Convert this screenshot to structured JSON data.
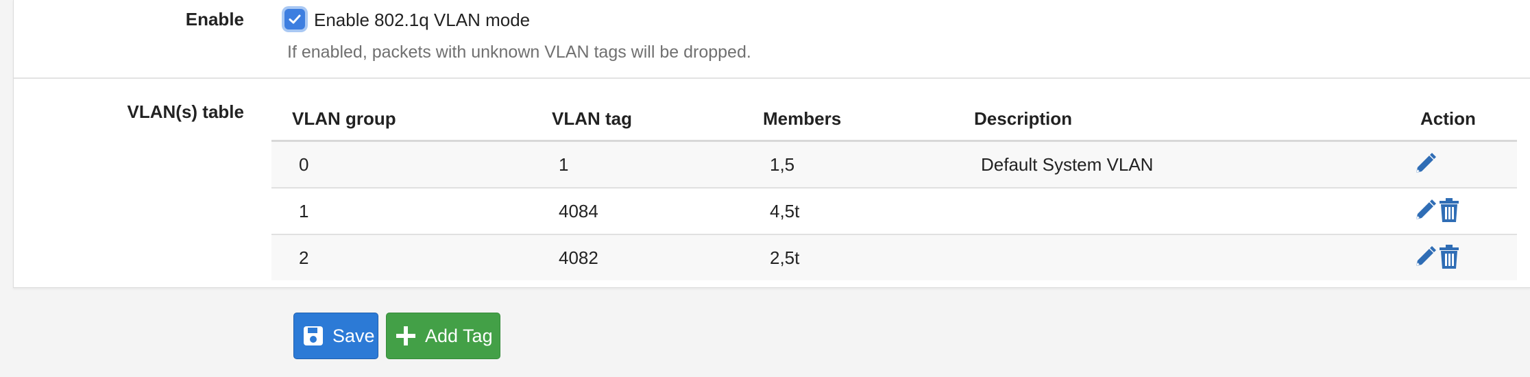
{
  "enable": {
    "label": "Enable",
    "checkbox_checked": true,
    "checkbox_label": "Enable 802.1q VLAN mode",
    "help": "If enabled, packets with unknown VLAN tags will be dropped."
  },
  "vlans": {
    "label": "VLAN(s) table",
    "headers": {
      "group": "VLAN group",
      "tag": "VLAN tag",
      "members": "Members",
      "description": "Description",
      "action": "Action"
    },
    "rows": [
      {
        "group": "0",
        "tag": "1",
        "members": "1,5",
        "description": "Default System VLAN",
        "actions": [
          "edit-icon"
        ]
      },
      {
        "group": "1",
        "tag": "4084",
        "members": "4,5t",
        "description": "",
        "actions": [
          "edit-icon",
          "trash-icon"
        ]
      },
      {
        "group": "2",
        "tag": "4082",
        "members": "2,5t",
        "description": "",
        "actions": [
          "edit-icon",
          "trash-icon"
        ]
      }
    ]
  },
  "buttons": {
    "save": {
      "label": "Save",
      "icon": "floppy-disk-icon",
      "color": "#2c7ad6"
    },
    "add_tag": {
      "label": "Add Tag",
      "icon": "plus-icon",
      "color": "#43a047"
    }
  },
  "colors": {
    "icon_blue": "#2f6db5",
    "checkbox": "#3d7ee0"
  }
}
